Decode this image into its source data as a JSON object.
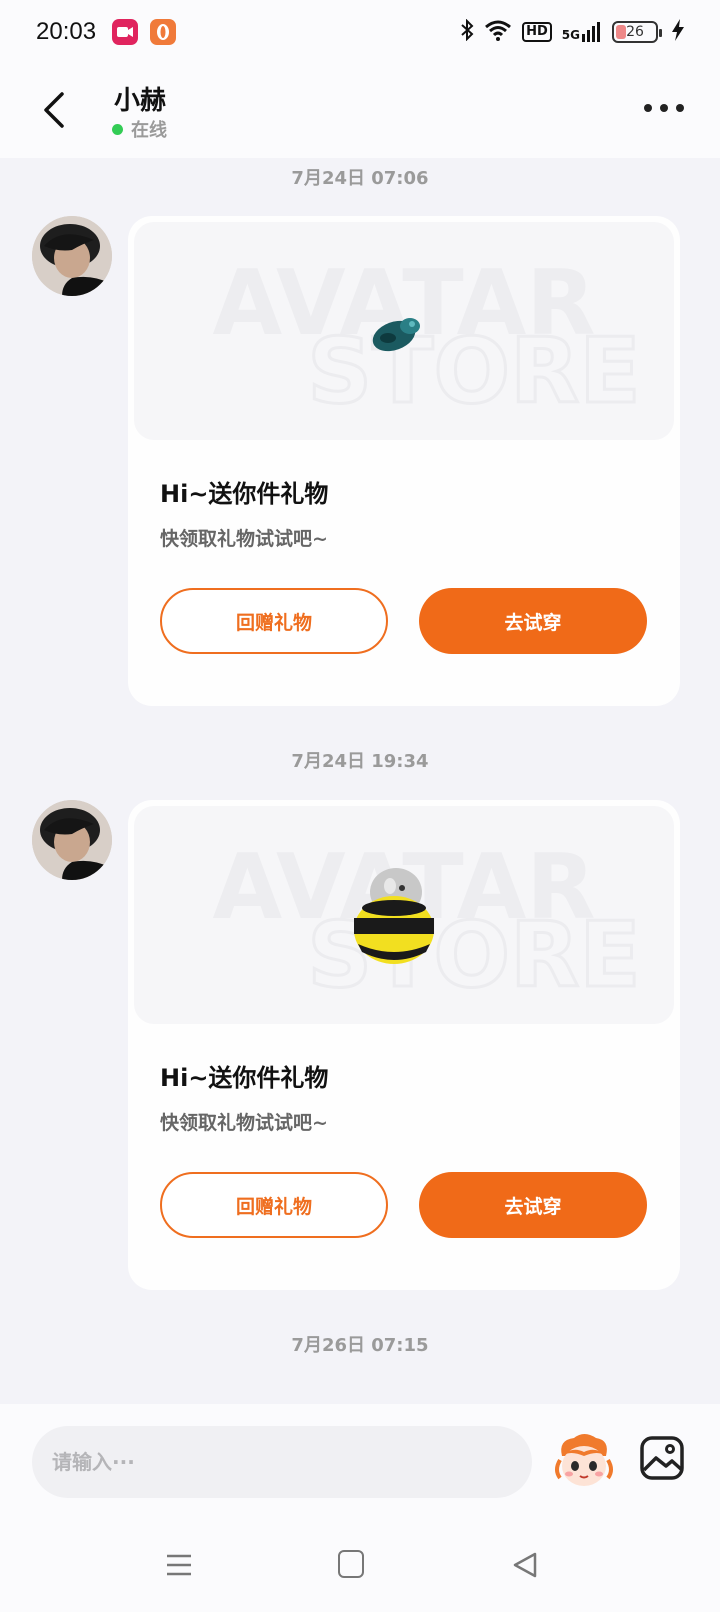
{
  "status_bar": {
    "time": "20:03",
    "hd": "HD",
    "network": "5G",
    "battery": "26"
  },
  "header": {
    "title": "小赫",
    "status": "在线"
  },
  "messages": [
    {
      "timestamp": "7月24日  07:06",
      "card_title": "Hi~送你件礼物",
      "card_subtitle": "快领取礼物试试吧~",
      "gift_button": "回赠礼物",
      "try_button": "去试穿",
      "watermark": [
        "AVATAR",
        "STORE"
      ]
    },
    {
      "timestamp": "7月24日  19:34",
      "card_title": "Hi~送你件礼物",
      "card_subtitle": "快领取礼物试试吧~",
      "gift_button": "回赠礼物",
      "try_button": "去试穿",
      "watermark": [
        "AVATAR",
        "STORE"
      ]
    }
  ],
  "last_timestamp": "7月26日  07:15",
  "input": {
    "placeholder": "请输入···"
  },
  "colors": {
    "accent": "#f06a18",
    "online": "#33cc55",
    "background": "#f3f3f8"
  },
  "icons": {
    "back": "chevron-left-icon",
    "more": "more-dots-icon",
    "mascot": "mascot-icon",
    "image": "image-icon"
  }
}
